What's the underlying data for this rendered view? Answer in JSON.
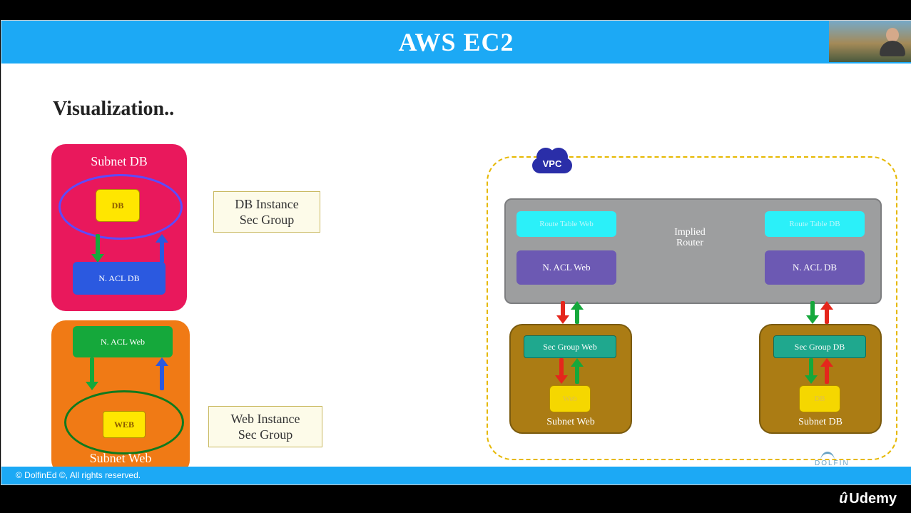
{
  "header": {
    "title": "AWS EC2"
  },
  "section_title": "Visualization..",
  "left": {
    "subnet_db": {
      "title": "Subnet DB",
      "db_box": "DB",
      "nacl": "N. ACL DB"
    },
    "subnet_web": {
      "title": "Subnet Web",
      "web_box": "WEB",
      "nacl": "N. ACL Web"
    },
    "sg_labels": {
      "db": "DB Instance\nSec Group",
      "web": "Web Instance\nSec Group"
    }
  },
  "right": {
    "vpc_label": "VPC",
    "router_label": "Implied\nRouter",
    "route_table_web": "Route Table Web",
    "route_table_db": "Route Table DB",
    "nacl_web": "N. ACL Web",
    "nacl_db": "N. ACL DB",
    "subnet_web": {
      "title": "Subnet Web",
      "sg": "Sec Group Web",
      "instance": "Web"
    },
    "subnet_db": {
      "title": "Subnet DB",
      "sg": "Sec Group DB",
      "instance": "DB"
    }
  },
  "footer": {
    "copyright": "© DolfinEd ©, All rights reserved."
  },
  "brand": {
    "name": "Udemy"
  },
  "watermark": "DOLFIN"
}
